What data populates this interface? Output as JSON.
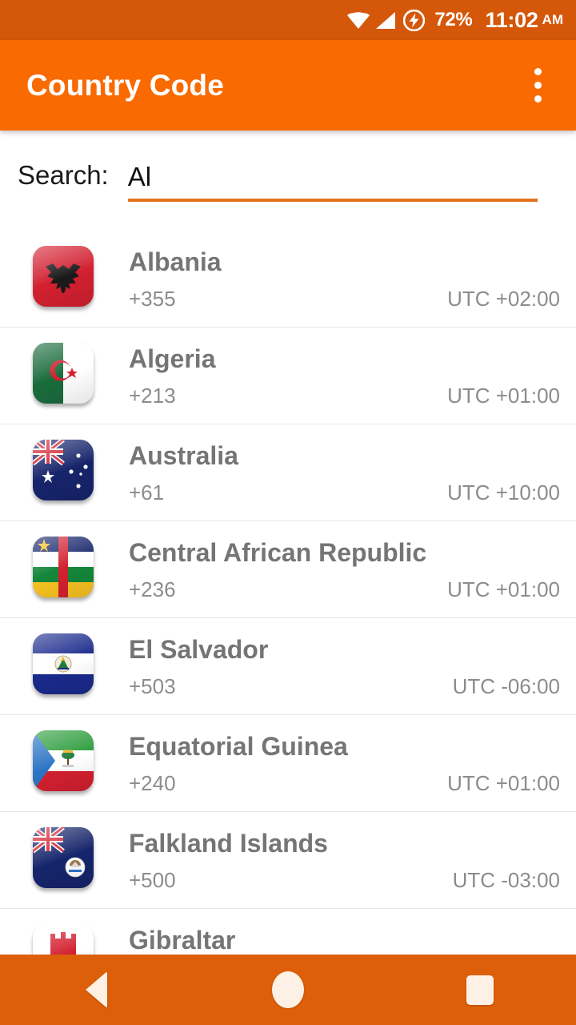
{
  "status_bar": {
    "wifi_icon": "wifi-icon",
    "signal_icon": "cell-signal-icon",
    "battery_icon": "battery-charging-icon",
    "battery_percent": "72%",
    "time": "11:02",
    "meridiem": "AM",
    "background_color": "#d4570a"
  },
  "app_bar": {
    "title": "Country Code",
    "overflow_icon": "overflow-menu-icon",
    "background_color": "#f96a00",
    "text_color": "#ffffff"
  },
  "search": {
    "label": "Search:",
    "value": "Al",
    "placeholder": "",
    "underline_color": "#e2711d"
  },
  "list": {
    "columns": [
      "country",
      "code",
      "utc"
    ],
    "rows": [
      {
        "country": "Albania",
        "code": "+355",
        "utc": "UTC +02:00",
        "flag": "flag-albania"
      },
      {
        "country": "Algeria",
        "code": "+213",
        "utc": "UTC +01:00",
        "flag": "flag-algeria"
      },
      {
        "country": "Australia",
        "code": "+61",
        "utc": "UTC +10:00",
        "flag": "flag-australia"
      },
      {
        "country": "Central African Republic",
        "code": "+236",
        "utc": "UTC +01:00",
        "flag": "flag-central-african-republic"
      },
      {
        "country": "El Salvador",
        "code": "+503",
        "utc": "UTC -06:00",
        "flag": "flag-el-salvador"
      },
      {
        "country": "Equatorial Guinea",
        "code": "+240",
        "utc": "UTC +01:00",
        "flag": "flag-equatorial-guinea"
      },
      {
        "country": "Falkland Islands",
        "code": "+500",
        "utc": "UTC -03:00",
        "flag": "flag-falkland-islands"
      },
      {
        "country": "Gibraltar",
        "code": "",
        "utc": "",
        "flag": "flag-gibraltar"
      }
    ]
  },
  "nav_bar": {
    "back_label": "back-button",
    "home_label": "home-button",
    "recents_label": "recents-button",
    "background_color": "#de5f09"
  }
}
